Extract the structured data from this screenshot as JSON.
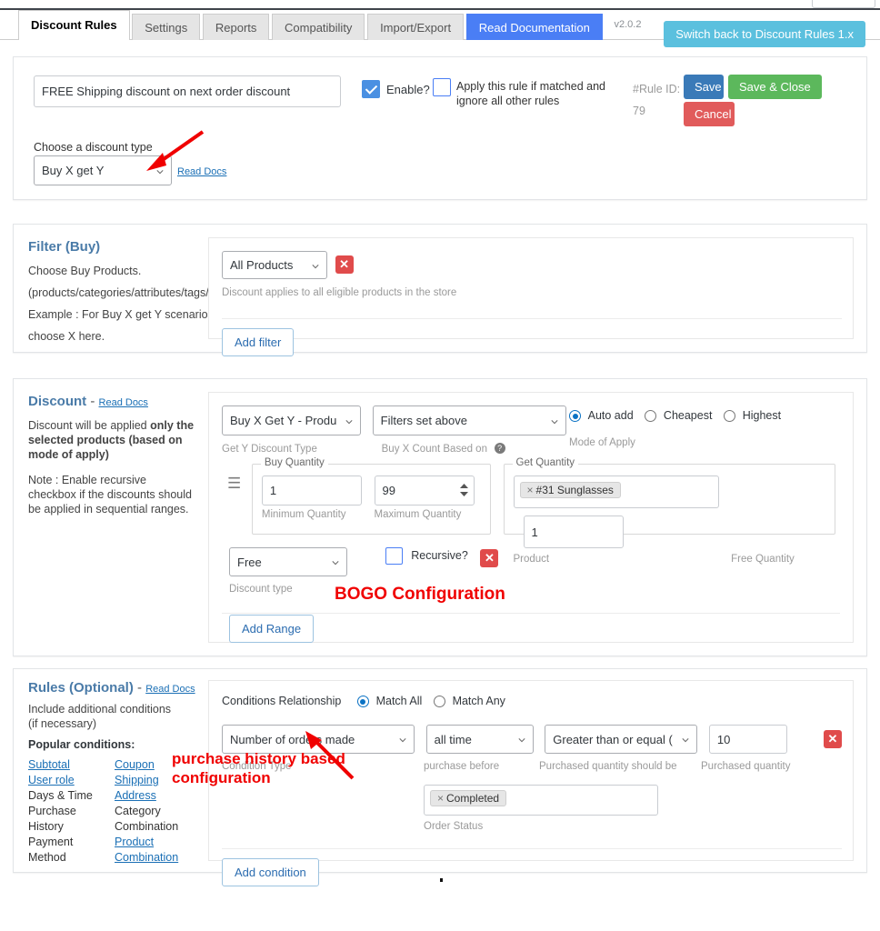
{
  "tabs": [
    {
      "label": "Discount Rules",
      "state": "active"
    },
    {
      "label": "Settings",
      "state": "normal"
    },
    {
      "label": "Reports",
      "state": "normal"
    },
    {
      "label": "Compatibility",
      "state": "normal"
    },
    {
      "label": "Import/Export",
      "state": "normal"
    },
    {
      "label": "Read Documentation",
      "state": "doc"
    }
  ],
  "version": "v2.0.2",
  "switch_back_label": "Switch back to Discount Rules 1.x",
  "rule_header": {
    "title_value": "FREE Shipping discount on next order discount",
    "title_placeholder": "Discount rule name",
    "enable_label": "Enable?",
    "enable_checked": true,
    "exclusive_label": "Apply this rule if matched and ignore all other rules",
    "exclusive_checked": false,
    "rule_id_label": "#Rule ID:",
    "rule_id_value": "79",
    "save_label": "Save",
    "save_close_label": "Save & Close",
    "cancel_label": "Cancel",
    "discount_type_label": "Choose a discount type",
    "discount_type_value": "Buy X get Y",
    "discount_type_options": [
      "Buy X get Y"
    ],
    "read_docs_label": "Read Docs"
  },
  "filter": {
    "title": "Filter (Buy)",
    "desc_lines": [
      "Choose Buy Products.",
      "(products/categories/attributes/tags/sku)",
      "Example : For Buy X get Y scenarios,",
      "choose X here."
    ],
    "select_value": "All Products",
    "select_options": [
      "All Products"
    ],
    "helper": "Discount applies to all eligible products in the store",
    "add_filter_label": "Add filter"
  },
  "discount": {
    "title": "Discount",
    "title_dash": "-",
    "read_docs_label": "Read Docs",
    "desc1_pre": "Discount will be applied ",
    "desc1_bold": "only the selected products (based on mode of apply)",
    "desc2": "Note : Enable recursive checkbox if the discounts should be applied in sequential ranges.",
    "get_y_type_value": "Buy X Get Y - Products",
    "get_y_type_label": "Get Y Discount Type",
    "count_based_value": "Filters set above",
    "count_based_label": "Buy X Count Based on",
    "mode_label": "Mode of Apply",
    "mode_options": [
      {
        "label": "Auto add",
        "selected": true
      },
      {
        "label": "Cheapest",
        "selected": false
      },
      {
        "label": "Highest",
        "selected": false
      }
    ],
    "buy_qty_legend": "Buy Quantity",
    "min_qty_value": "1",
    "min_qty_label": "Minimum Quantity",
    "max_qty_value": "99",
    "max_qty_label": "Maximum Quantity",
    "get_qty_legend": "Get Quantity",
    "product_token": "#31 Sunglasses",
    "product_label": "Product",
    "free_qty_value": "1",
    "free_qty_label": "Free Quantity",
    "discount_type_value": "Free",
    "discount_type_label": "Discount type",
    "recursive_label": "Recursive?",
    "recursive_checked": false,
    "add_range_label": "Add Range"
  },
  "rules": {
    "title": "Rules (Optional)",
    "title_dash": "-",
    "read_docs_label": "Read Docs",
    "desc": "Include additional conditions (if necessary)",
    "popular_label": "Popular conditions:",
    "popular_left": [
      {
        "label": "Subtotal",
        "link": true
      },
      {
        "label": "User role",
        "link": true
      },
      {
        "label": "Days & Time",
        "link": false
      },
      {
        "label": "Purchase History",
        "link": false
      },
      {
        "label": "Payment Method",
        "link": false
      }
    ],
    "popular_right": [
      {
        "label": "Coupon",
        "link": true
      },
      {
        "label": "Shipping Address",
        "link": true
      },
      {
        "label": "Category Combination",
        "link": false
      },
      {
        "label": "Product Combination",
        "link": true
      }
    ],
    "relationship_label": "Conditions Relationship",
    "relationship_options": [
      {
        "label": "Match All",
        "selected": true
      },
      {
        "label": "Match Any",
        "selected": false
      }
    ],
    "condition_type_value": "Number of orders made",
    "condition_type_label": "Condition Type",
    "purchase_before_value": "all time",
    "purchase_before_label": "purchase before",
    "comparator_value": "Greater than or equal ( >= )",
    "comparator_label": "Purchased quantity should be",
    "quantity_value": "10",
    "quantity_label": "Purchased quantity",
    "order_status_token": "Completed",
    "order_status_label": "Order Status",
    "add_condition_label": "Add condition"
  },
  "annotations": [
    {
      "text": "BOGO Configuration"
    },
    {
      "text": "purchase history based"
    },
    {
      "text": "configuration"
    }
  ],
  "colors": {
    "accent_blue": "#4a7ef5",
    "switch_cyan": "#5bc0de",
    "save_blue": "#3a7ab8",
    "save_green": "#5cb85c",
    "cancel_red": "#e15b5b",
    "delete_red": "#e04b4b",
    "annotation_red": "#f00000",
    "section_heading": "#4a7ba8"
  }
}
